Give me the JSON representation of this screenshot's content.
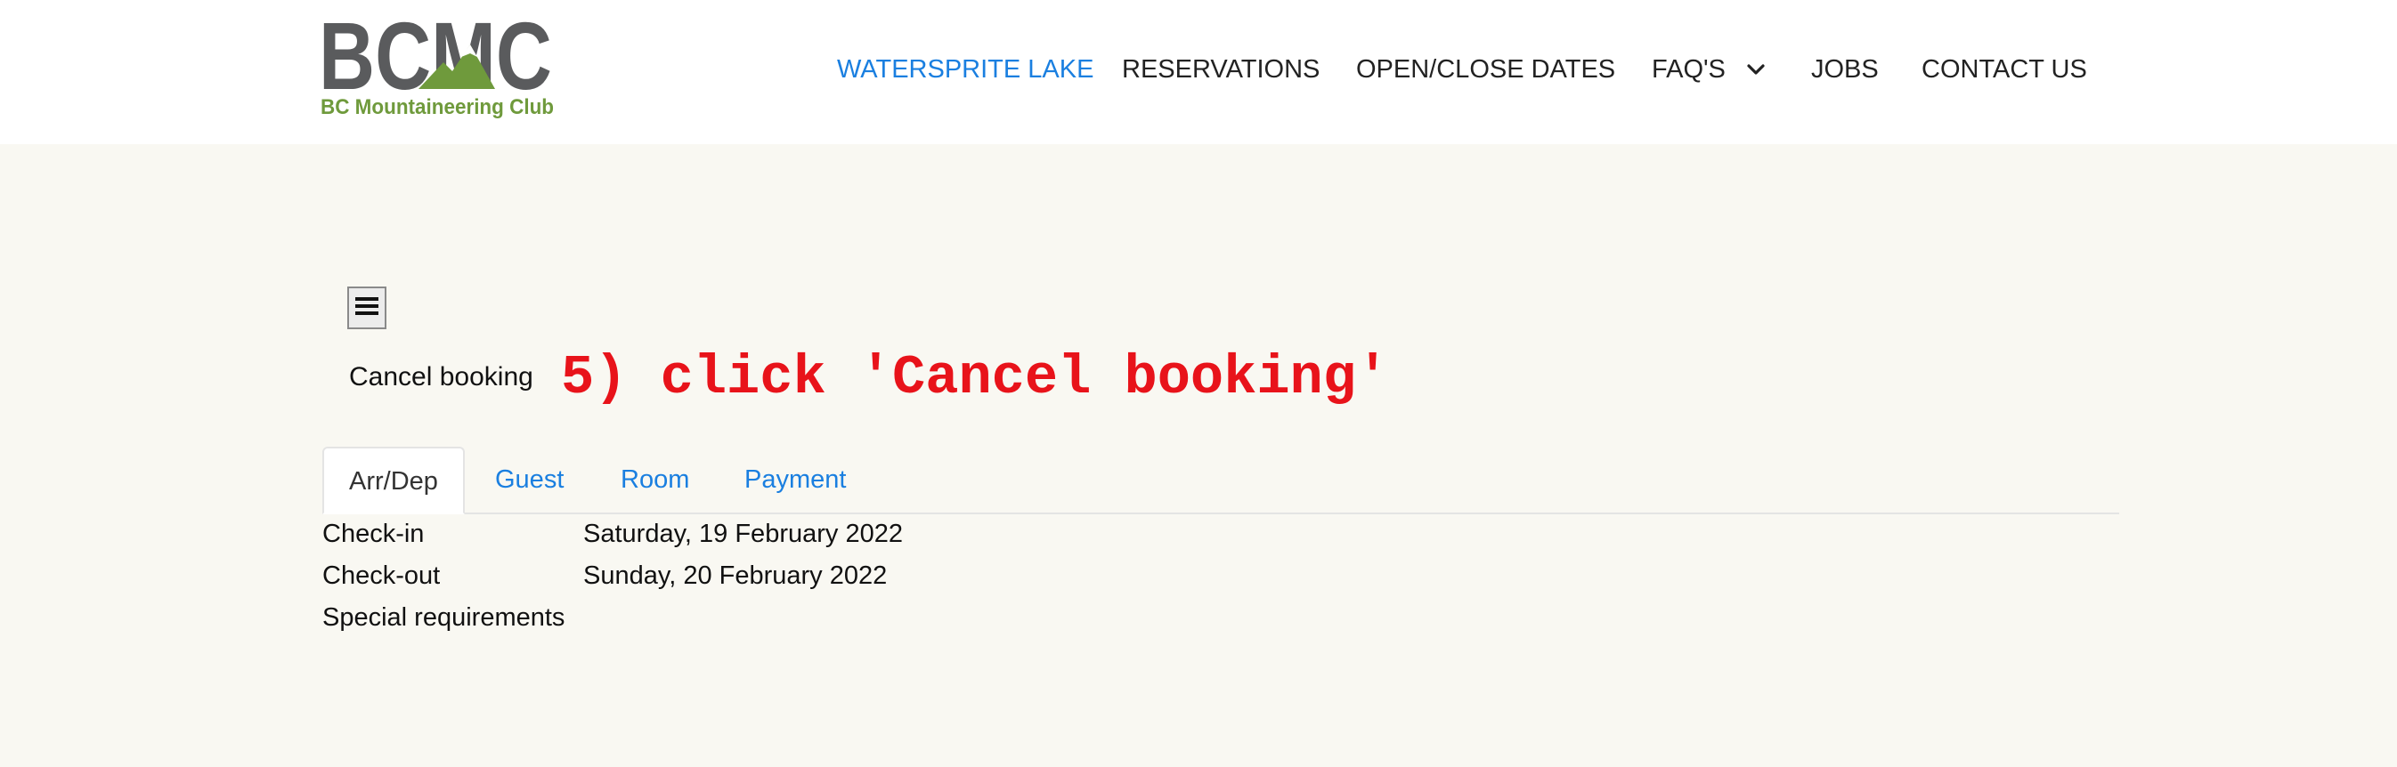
{
  "logo": {
    "wordmark": "BCMC",
    "tagline": "BC Mountaineering Club",
    "colors": {
      "gray": "#5a5b5d",
      "green": "#6f9a3c"
    }
  },
  "nav": {
    "items": [
      {
        "label": "WATERSPRITE LAKE",
        "active": true
      },
      {
        "label": "RESERVATIONS"
      },
      {
        "label": "OPEN/CLOSE DATES"
      },
      {
        "label": "FAQ'S",
        "icon": "chevron-down-icon"
      },
      {
        "label": "JOBS"
      },
      {
        "label": "CONTACT US"
      }
    ]
  },
  "menu_button": {
    "icon": "hamburger-menu-icon",
    "glyph": "☰"
  },
  "cancel_link": "Cancel booking",
  "annotation": "5) click 'Cancel booking'",
  "tabs": [
    {
      "label": "Arr/Dep",
      "active": true
    },
    {
      "label": "Guest"
    },
    {
      "label": "Room"
    },
    {
      "label": "Payment"
    }
  ],
  "details": [
    {
      "label": "Check-in",
      "value": "Saturday, 19 February 2022"
    },
    {
      "label": "Check-out",
      "value": "Sunday, 20 February 2022"
    },
    {
      "label": "Special requirements",
      "value": ""
    }
  ],
  "colors": {
    "accent": "#1a7fe0",
    "annotation": "#e8131a",
    "background": "#f9f8f2"
  }
}
